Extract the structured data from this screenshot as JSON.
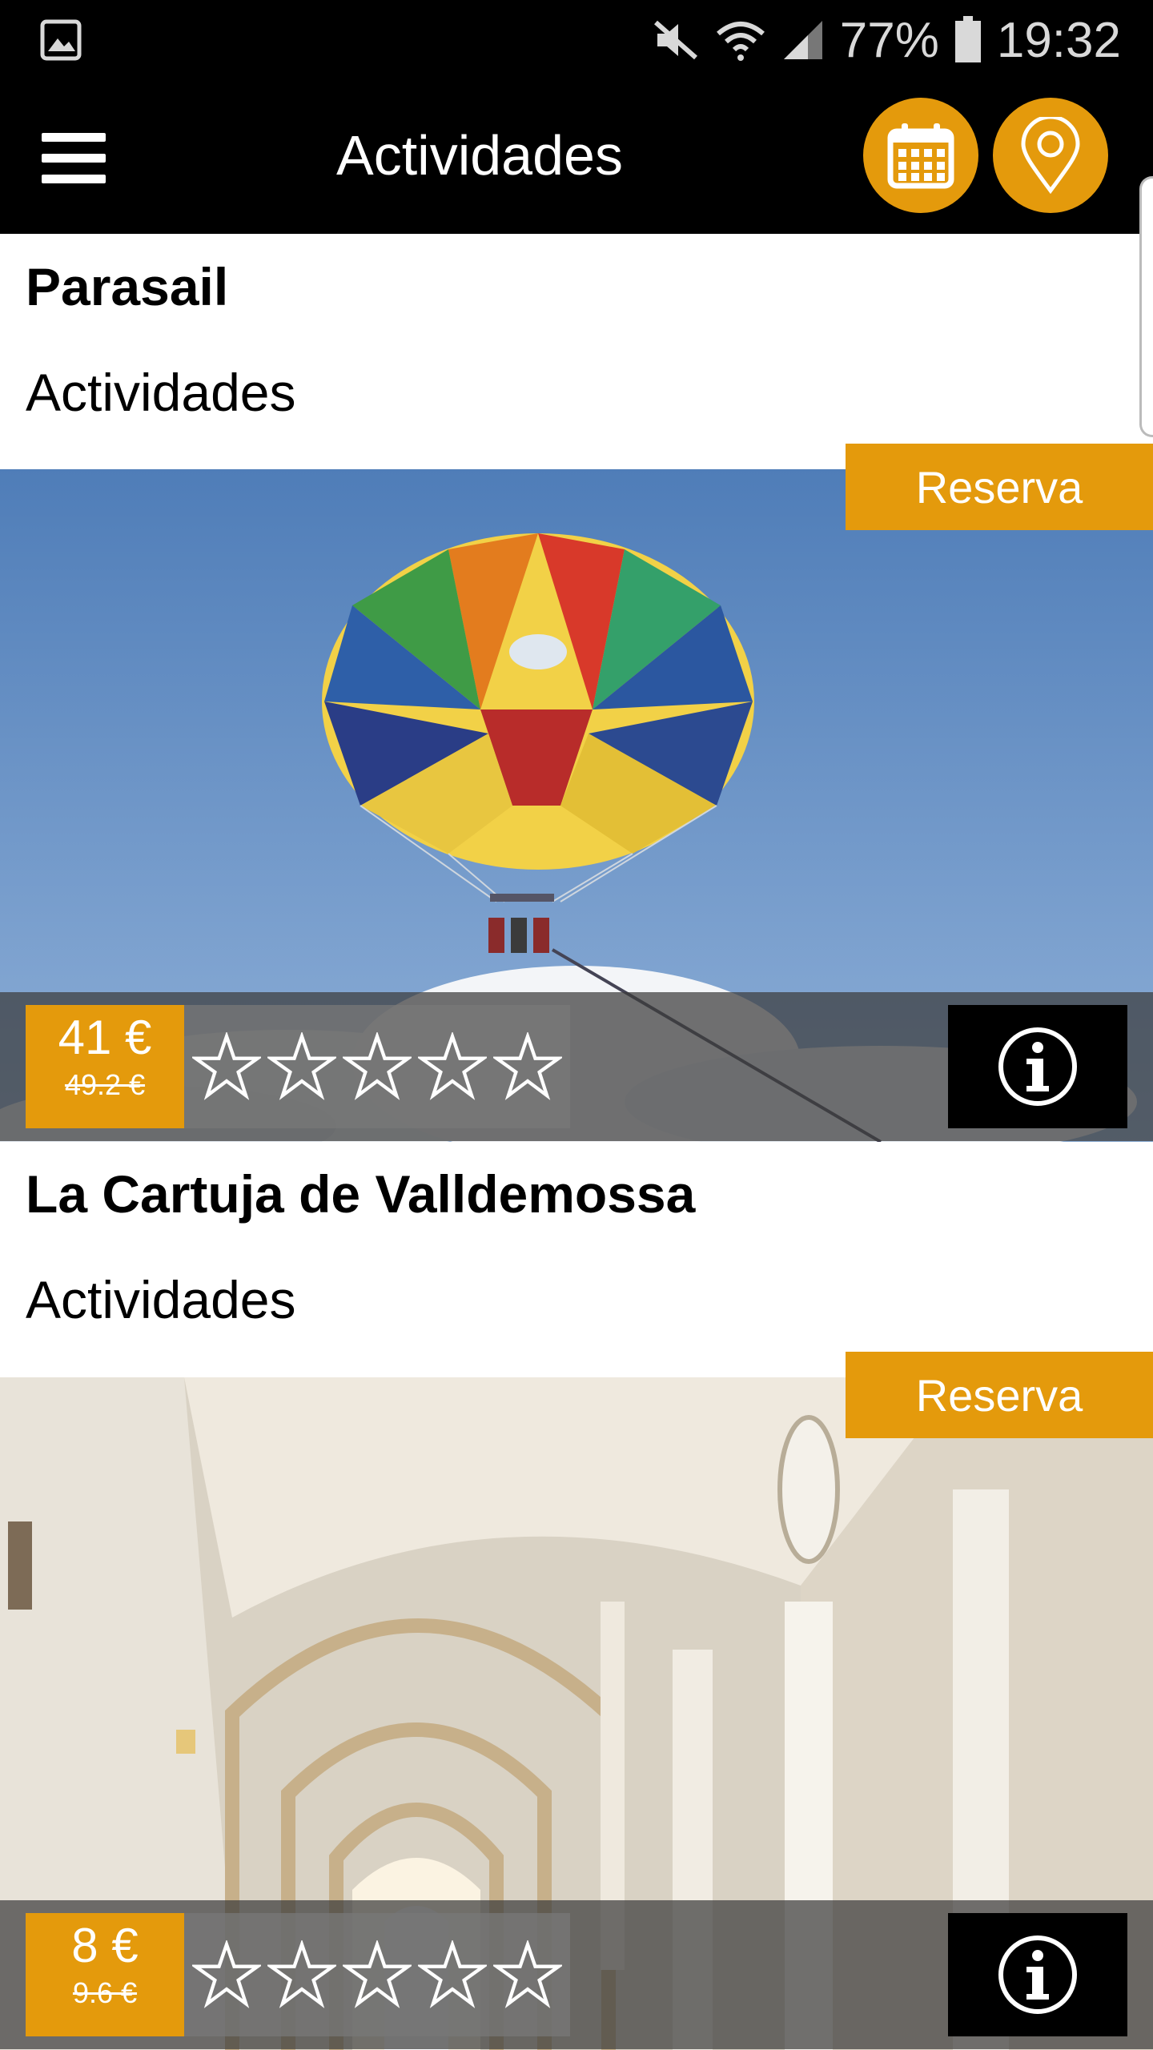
{
  "status_bar": {
    "battery": "77%",
    "time": "19:32"
  },
  "app_bar": {
    "title": "Actividades"
  },
  "cards": [
    {
      "title": "Parasail",
      "category": "Actividades",
      "reserve_label": "Reserva",
      "price": "41 €",
      "old_price": "49.2 €",
      "rating": 0
    },
    {
      "title": "La Cartuja de Valldemossa",
      "category": "Actividades",
      "reserve_label": "Reserva",
      "price": "8 €",
      "old_price": "9.6 €",
      "rating": 0
    }
  ],
  "colors": {
    "accent": "#e49a0c",
    "bar": "#000000"
  },
  "icons": [
    "gallery-icon",
    "mute-icon",
    "wifi-icon",
    "signal-icon",
    "battery-icon",
    "menu-icon",
    "calendar-icon",
    "location-pin-icon",
    "star-icon",
    "info-icon"
  ]
}
